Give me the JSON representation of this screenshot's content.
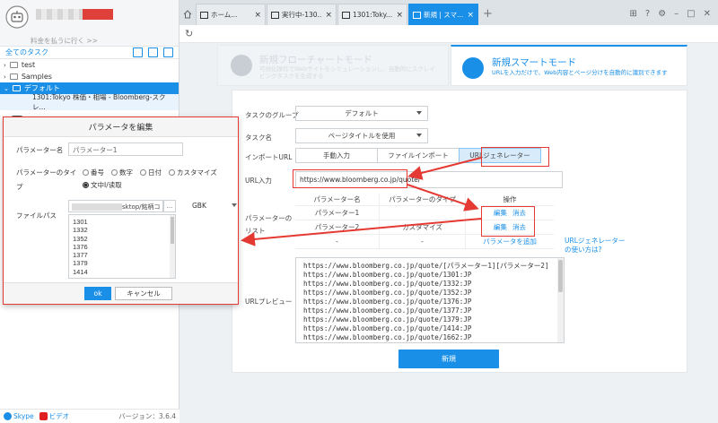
{
  "sidebar": {
    "pay_link": "料金を払うに行く >>",
    "all_tasks": "全てのタスク",
    "tree": [
      {
        "label": "test"
      },
      {
        "label": "Samples"
      },
      {
        "label": "デフォルト"
      }
    ],
    "task_item": "1301:Tokyo 株価・相場 - Bloomberg-スクレ...",
    "skype": "Skype",
    "video": "ビデオ",
    "version": "バージョン：3.6.4"
  },
  "tabs": [
    {
      "label": "ホーム..."
    },
    {
      "label": "実行中-130..."
    },
    {
      "label": "1301:Toky..."
    },
    {
      "label": "新規 | スマ..."
    }
  ],
  "modes": {
    "flow_title": "新規フローチャートモード",
    "flow_desc": "可視化操作でWebサイトをシミュレーションし、自動的にスクレイピングタスクを生成する",
    "smart_title": "新規スマートモード",
    "smart_desc": "URLを入力だけで、Web内容とページ分けを自動的に識別できます"
  },
  "form": {
    "group_label": "タスクのグループ",
    "group_value": "デフォルト",
    "name_label": "タスク名",
    "name_value": "ページタイトルを使用",
    "import_label": "インポートURL",
    "import_tabs": [
      "手動入力",
      "ファイルインポート",
      "URLジェネレーター"
    ],
    "url_label": "URL入力",
    "url_value": "https://www.bloomberg.co.jp/quote/",
    "param_list_label": "パラメーターのリスト",
    "param_headers": [
      "パラメーター名",
      "パラメーターのタイプ",
      "操作"
    ],
    "params": [
      {
        "name": "パラメーター1",
        "type": "",
        "edit": "編集",
        "del": "消去"
      },
      {
        "name": "パラメーター2",
        "type": "カスタマイズ",
        "edit": "編集",
        "del": "消去"
      }
    ],
    "add_row": {
      "c1": "-",
      "c2": "-",
      "add": "パラメータを追加"
    },
    "help_link": "URLジェネレーターの使い方は?",
    "preview_label": "URLプレビュー",
    "preview_lines": [
      "https://www.bloomberg.co.jp/quote/[パラメーター1][パラメーター2]",
      "https://www.bloomberg.co.jp/quote/1301:JP",
      "https://www.bloomberg.co.jp/quote/1332:JP",
      "https://www.bloomberg.co.jp/quote/1352:JP",
      "https://www.bloomberg.co.jp/quote/1376:JP",
      "https://www.bloomberg.co.jp/quote/1377:JP",
      "https://www.bloomberg.co.jp/quote/1379:JP",
      "https://www.bloomberg.co.jp/quote/1414:JP",
      "https://www.bloomberg.co.jp/quote/1662:JP"
    ],
    "create_btn": "新規"
  },
  "dialog": {
    "title": "パラメータを編集",
    "name_label": "パラメーター名",
    "name_value": "パラメーター1",
    "type_label_1": "パラメーターのタイ",
    "type_label_2": "プ",
    "types": [
      "番号",
      "数字",
      "日付",
      "カスタマイズ"
    ],
    "selected_type": "文中I/读取",
    "file_label": "ファイルパス",
    "file_path_suffix": "sktop/銘柄コ",
    "browse": "...",
    "encoding": "GBK",
    "file_list": [
      "1301",
      "1332",
      "1352",
      "1376",
      "1377",
      "1379",
      "1414"
    ],
    "ok": "ok",
    "cancel": "キャンセル"
  },
  "colors": {
    "accent": "#1a8fe8",
    "highlight": "#e53a33"
  }
}
